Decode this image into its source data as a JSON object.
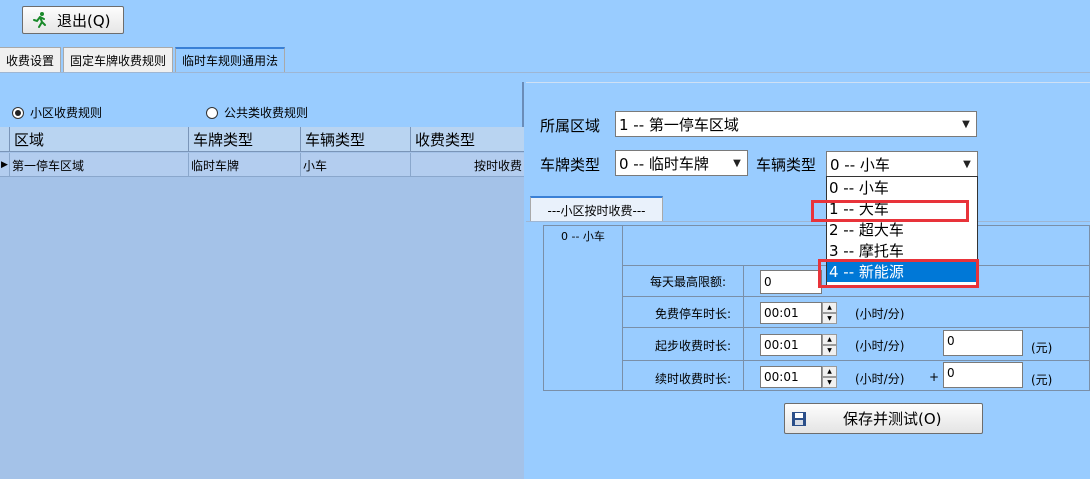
{
  "toolbar": {
    "exit_label": "退出(Q)"
  },
  "tabs": [
    {
      "label": "收费设置"
    },
    {
      "label": "固定车牌收费规则"
    },
    {
      "label": "临时车规则通用法"
    }
  ],
  "left": {
    "radio_community": "小区收费规则",
    "radio_public": "公共类收费规则",
    "columns": [
      "区域",
      "车牌类型",
      "车辆类型",
      "收费类型"
    ],
    "rows": [
      [
        "第一停车区域",
        "临时车牌",
        "小车",
        "按时收费"
      ]
    ],
    "row_indicator": "▶"
  },
  "right": {
    "area_label": "所属区域",
    "area_value": "1 -- 第一停车区域",
    "plate_label": "车牌类型",
    "plate_value": "0 -- 临时车牌",
    "vehicle_label": "车辆类型",
    "vehicle_value": "0 -- 小车",
    "vehicle_options": [
      "0 -- 小车",
      "1 -- 大车",
      "2 -- 超大车",
      "3 -- 摩托车",
      "4 -- 新能源"
    ],
    "inner_tab": "---小区按时收费---",
    "fee_section_title": "0 -- 小车",
    "max_label": "每天最高限额:",
    "max_value": "0",
    "free_label": "免费停车时长:",
    "free_value": "00:01",
    "free_unit": "(小时/分)",
    "start_label": "起步收费时长:",
    "start_value": "00:01",
    "start_unit": "(小时/分)",
    "start_fee": "0",
    "start_fee_unit": "(元)",
    "cont_label": "续时收费时长:",
    "cont_value": "00:01",
    "cont_unit": "(小时/分)",
    "cont_plus": "+",
    "cont_fee": "0",
    "cont_fee_unit": "(元)",
    "save_label": "保存并测试(O)"
  },
  "colors": {
    "background": "#99ccff",
    "highlight": "#e8333a",
    "selected": "#0078d7"
  }
}
